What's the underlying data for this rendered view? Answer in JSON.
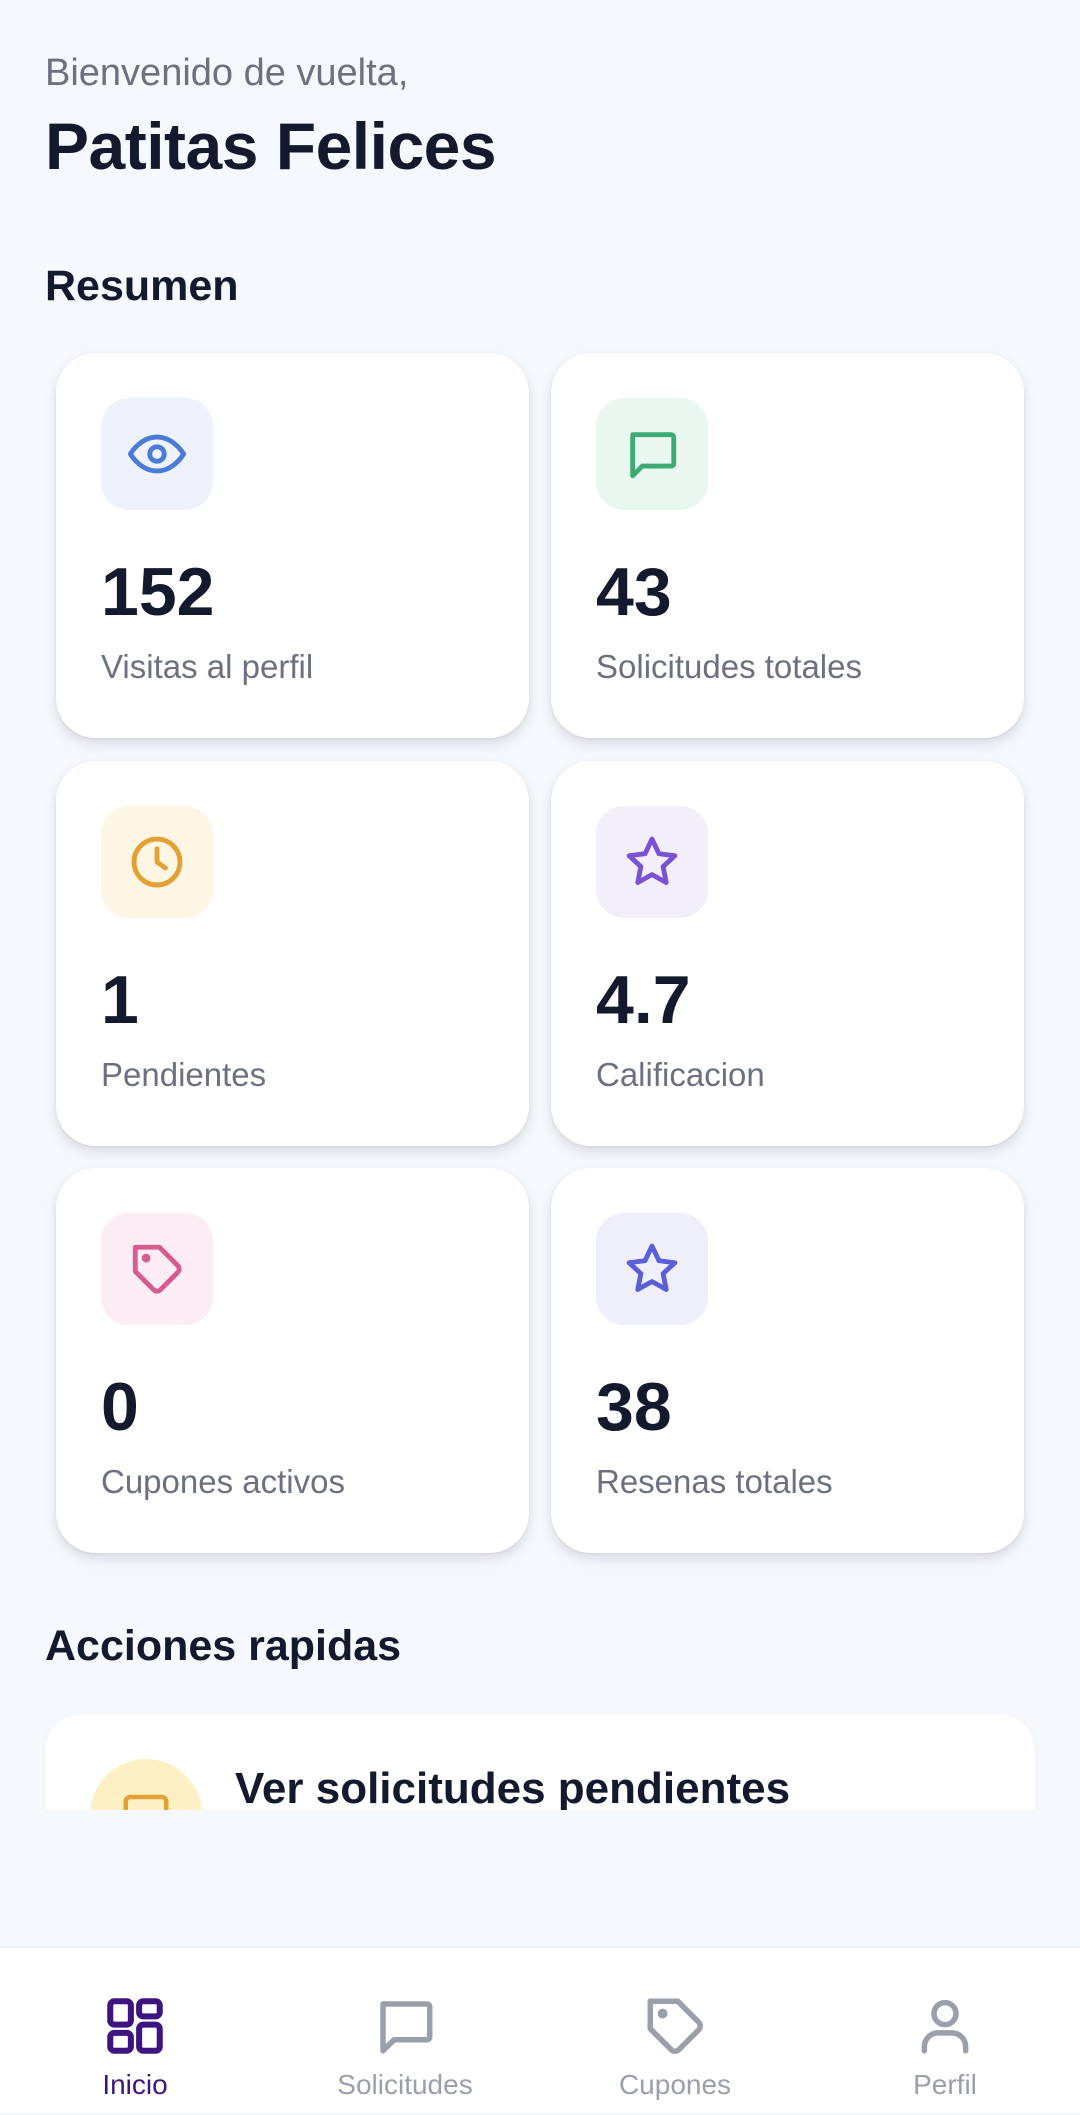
{
  "header": {
    "greeting": "Bienvenido de vuelta,",
    "business_name": "Patitas Felices"
  },
  "summary": {
    "title": "Resumen",
    "cards": [
      {
        "value": "152",
        "label": "Visitas al perfil",
        "icon": "eye-icon",
        "tint": "#eef2fc",
        "color": "#4a7bd6"
      },
      {
        "value": "43",
        "label": "Solicitudes totales",
        "icon": "message-icon",
        "tint": "#eaf7f0",
        "color": "#3daa73"
      },
      {
        "value": "1",
        "label": "Pendientes",
        "icon": "clock-icon",
        "tint": "#fef6e4",
        "color": "#e2a132"
      },
      {
        "value": "4.7",
        "label": "Calificacion",
        "icon": "star-icon",
        "tint": "#f2effb",
        "color": "#7a52d4"
      },
      {
        "value": "0",
        "label": "Cupones activos",
        "icon": "tag-icon",
        "tint": "#fcecf3",
        "color": "#d65b8f"
      },
      {
        "value": "38",
        "label": "Resenas totales",
        "icon": "star-icon",
        "tint": "#efeffb",
        "color": "#5a5fd8"
      }
    ]
  },
  "quick_actions": {
    "title": "Acciones rapidas",
    "items": [
      {
        "label": "Ver solicitudes pendientes",
        "icon": "inbox-icon",
        "color": "#e2a132"
      }
    ]
  },
  "bottom_nav": {
    "items": [
      {
        "label": "Inicio",
        "icon": "grid-icon",
        "active": true
      },
      {
        "label": "Solicitudes",
        "icon": "message-icon",
        "active": false
      },
      {
        "label": "Cupones",
        "icon": "tag-icon",
        "active": false
      },
      {
        "label": "Perfil",
        "icon": "user-icon",
        "active": false
      }
    ],
    "active_color": "#3e1580",
    "inactive_color": "#9aa0ab"
  }
}
